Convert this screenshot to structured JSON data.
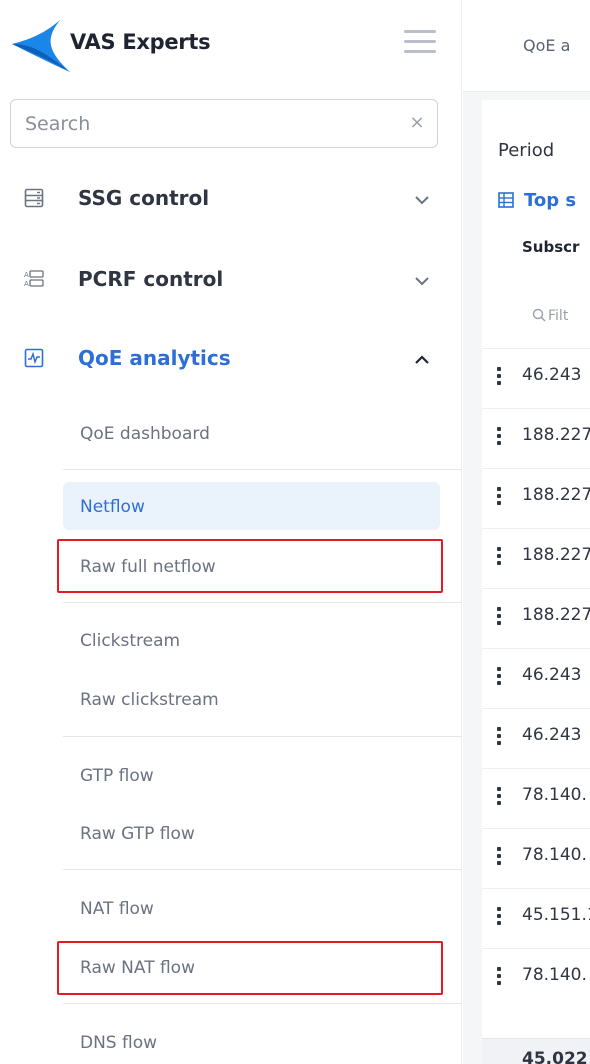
{
  "brand": {
    "name": "VAS Experts"
  },
  "search": {
    "placeholder": "Search",
    "value": "",
    "clear_glyph": "×"
  },
  "sections": [
    {
      "label": "SSG control",
      "icon": "server-icon",
      "expanded": false
    },
    {
      "label": "PCRF control",
      "icon": "pcrf-icon",
      "expanded": false
    },
    {
      "label": "QoE analytics",
      "icon": "analytics-icon",
      "expanded": true
    }
  ],
  "qoe_items": {
    "dashboard": "QoE dashboard",
    "netflow": "Netflow",
    "raw_full_netflow": "Raw full netflow",
    "clickstream": "Clickstream",
    "raw_clickstream": "Raw clickstream",
    "gtp_flow": "GTP flow",
    "raw_gtp_flow": "Raw GTP flow",
    "nat_flow": "NAT flow",
    "raw_nat_flow": "Raw NAT flow",
    "dns_flow": "DNS flow"
  },
  "active_item": "Netflow",
  "highlighted_items": [
    "Raw full netflow",
    "Raw NAT flow"
  ],
  "main": {
    "tab_title": "QoE a",
    "period_label": "Period",
    "top_link": "Top s",
    "column_header": "Subscr",
    "filter_placeholder": "Filt",
    "rows": [
      "46.243",
      "188.227",
      "188.227",
      "188.227",
      "188.227",
      "46.243",
      "46.243",
      "78.140.",
      "78.140.",
      "45.151.1",
      "78.140."
    ],
    "total": "45,022"
  },
  "colors": {
    "accent": "#2e6fd6",
    "active_bg": "#eaf2fc",
    "highlight_border": "#e31b23",
    "brand_logo": "#1a86e8"
  }
}
